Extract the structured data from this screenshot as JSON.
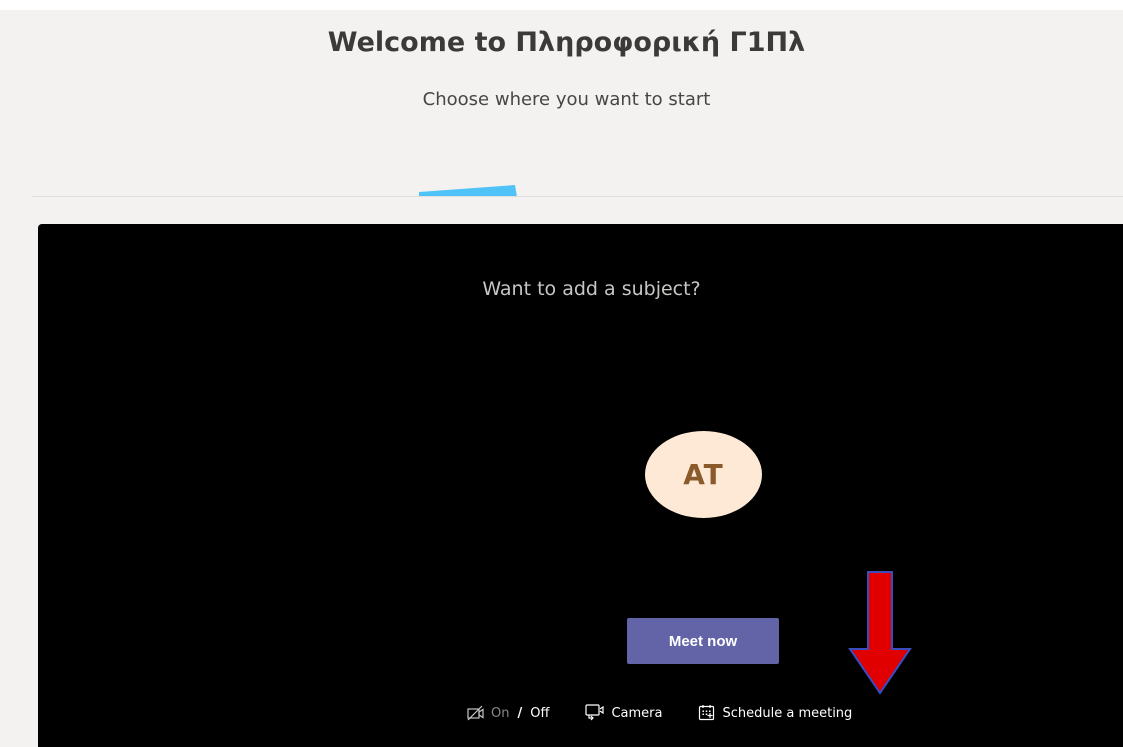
{
  "header": {
    "title": "Welcome to Πληροφορική Γ1Πλ",
    "subtitle": "Choose where you want to start"
  },
  "meeting": {
    "subject_prompt": "Want to add a subject?",
    "avatar_initials": "AT",
    "meet_now_label": "Meet now",
    "video_toggle": {
      "on_label": "On",
      "separator": "/",
      "off_label": "Off"
    },
    "camera_label": "Camera",
    "schedule_label": "Schedule a meeting"
  },
  "colors": {
    "accent": "#6264a7",
    "tab_indicator": "#4fc3f7",
    "avatar_bg": "#fde9d6",
    "avatar_text": "#8a5a2b",
    "annotation_arrow": "#e00000"
  },
  "icons": {
    "video_toggle": "video-off-icon",
    "camera": "camera-switch-icon",
    "schedule": "calendar-add-icon",
    "annotation": "red-down-arrow"
  }
}
